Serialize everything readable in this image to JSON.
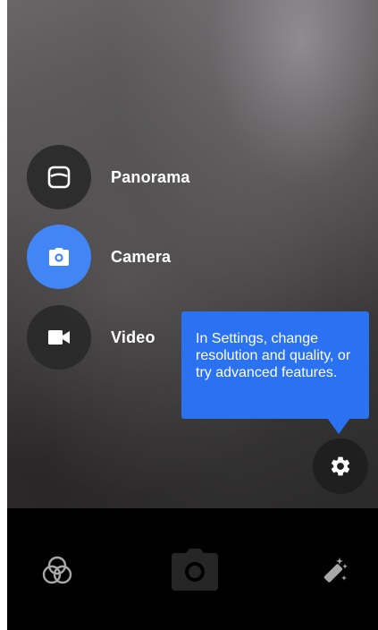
{
  "modes": [
    {
      "id": "panorama",
      "label": "Panorama",
      "icon": "panorama-icon",
      "active": false
    },
    {
      "id": "camera",
      "label": "Camera",
      "icon": "camera-icon",
      "active": true
    },
    {
      "id": "video",
      "label": "Video",
      "icon": "video-icon",
      "active": false
    }
  ],
  "tooltip": {
    "text": "In Settings, change resolution and quality, or try advanced features."
  },
  "settings": {
    "icon": "gear-icon"
  },
  "bottom_bar": {
    "left_icon": "filters-icon",
    "center_icon": "shutter-camera-icon",
    "right_icon": "magic-wand-icon"
  },
  "colors": {
    "accent": "#4285f4",
    "tooltip": "#2b72f2",
    "bottom_bar": "#000000"
  }
}
